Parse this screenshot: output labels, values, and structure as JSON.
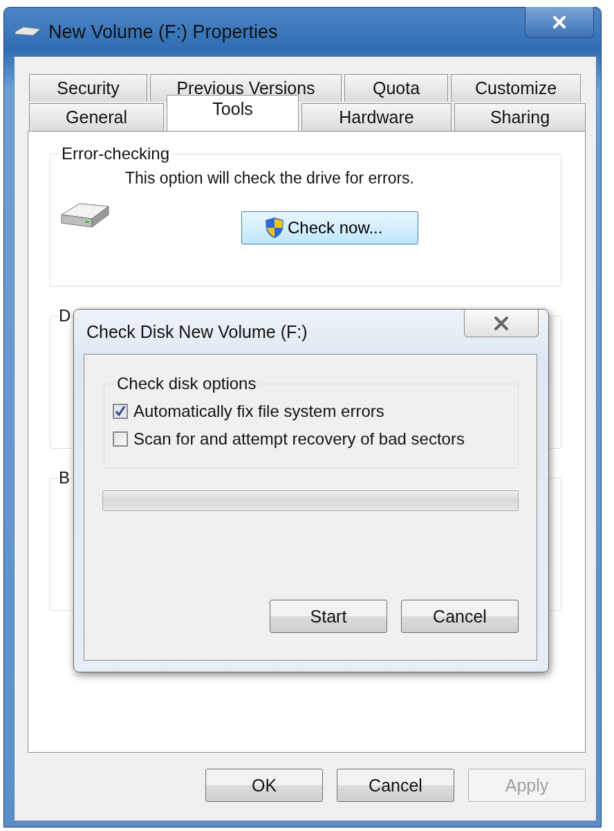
{
  "window": {
    "title": "New Volume (F:) Properties"
  },
  "tab_rows": [
    [
      {
        "label": "Security",
        "selected": false
      },
      {
        "label": "Previous Versions",
        "selected": false
      },
      {
        "label": "Quota",
        "selected": false
      },
      {
        "label": "Customize",
        "selected": false
      }
    ],
    [
      {
        "label": "General",
        "selected": false
      },
      {
        "label": "Tools",
        "selected": true
      },
      {
        "label": "Hardware",
        "selected": false
      },
      {
        "label": "Sharing",
        "selected": false
      }
    ]
  ],
  "error_checking": {
    "title": "Error-checking",
    "description": "This option will check the drive for errors.",
    "button": "Check now..."
  },
  "partial_groups": [
    {
      "title": "D"
    },
    {
      "title": "B"
    }
  ],
  "check_disk_dialog": {
    "title": "Check Disk New Volume (F:)",
    "options_title": "Check disk options",
    "options": [
      {
        "label": "Automatically fix file system errors",
        "checked": true
      },
      {
        "label": "Scan for and attempt recovery of bad sectors",
        "checked": false
      }
    ],
    "progress": {
      "level": 0
    },
    "buttons": [
      {
        "label": "Start"
      },
      {
        "label": "Cancel"
      }
    ]
  },
  "buttons": [
    {
      "label": "OK",
      "disabled": false
    },
    {
      "label": "Cancel",
      "disabled": false
    },
    {
      "label": "Apply",
      "disabled": true
    }
  ]
}
